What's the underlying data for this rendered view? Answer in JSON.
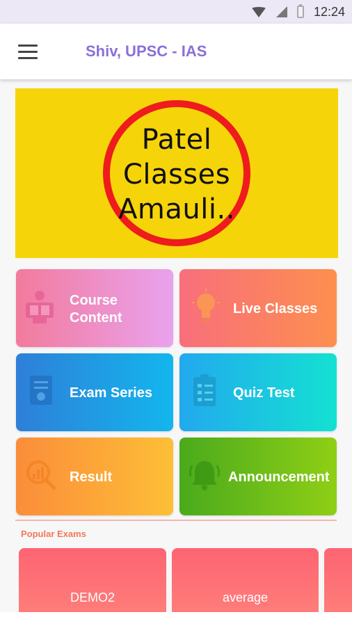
{
  "status_bar": {
    "time": "12:24",
    "icons": [
      "wifi-icon",
      "signal-icon",
      "battery-icon"
    ]
  },
  "app_bar": {
    "title": "Shiv, UPSC - IAS",
    "menu_icon": "hamburger-menu-icon",
    "title_color": "#8b6fd9"
  },
  "banner": {
    "logo_lines": [
      "Patel",
      "Classes",
      "Amauli.."
    ],
    "background": "#f6d40a",
    "ring_color": "#ee1c1c"
  },
  "tiles": [
    {
      "label_line1": "Course",
      "label_line2": "Content",
      "icon": "reading-person-icon"
    },
    {
      "label": "Live Classes",
      "icon": "lightbulb-icon"
    },
    {
      "label": "Exam Series",
      "icon": "exam-paper-icon"
    },
    {
      "label": "Quiz Test",
      "icon": "clipboard-checklist-icon"
    },
    {
      "label": "Result",
      "icon": "magnifier-chart-icon"
    },
    {
      "label": "Announcement",
      "icon": "bell-icon"
    }
  ],
  "popular_exams": {
    "title": "Popular Exams",
    "items": [
      "DEMO2",
      "average"
    ]
  }
}
